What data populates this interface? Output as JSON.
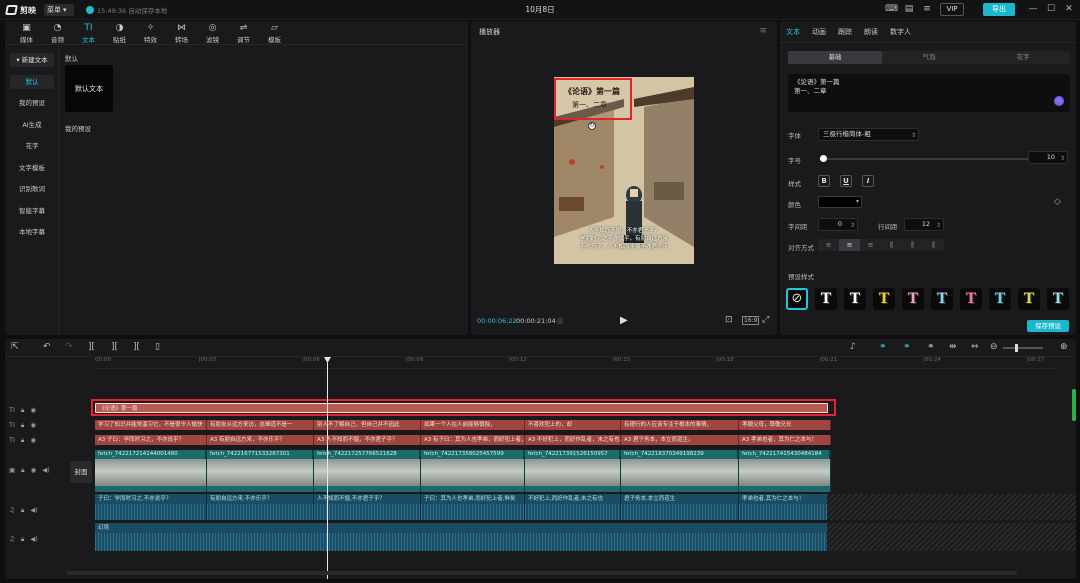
{
  "titlebar": {
    "app_name": "剪映",
    "menu_label": "菜单",
    "autosave_text": "15:49:36 自动保存本地",
    "doc_title": "10月8日",
    "vip_label": "VIP",
    "export_label": "导出"
  },
  "left_panel": {
    "tabs": [
      {
        "icon": "▣",
        "label": "媒体"
      },
      {
        "icon": "◔",
        "label": "音频"
      },
      {
        "icon": "TI",
        "label": "文本"
      },
      {
        "icon": "◑",
        "label": "贴纸"
      },
      {
        "icon": "✧",
        "label": "特效"
      },
      {
        "icon": "⋈",
        "label": "转场"
      },
      {
        "icon": "◎",
        "label": "滤镜"
      },
      {
        "icon": "⇌",
        "label": "调节"
      },
      {
        "icon": "▱",
        "label": "模板"
      }
    ],
    "sidebar": [
      "▾ 新建文本",
      "默认",
      "我的预设",
      "AI生成",
      "花字",
      "文字模板",
      "识别歌词",
      "智能字幕",
      "本地字幕"
    ],
    "section_default": "默认",
    "default_card": "默认文本",
    "section_my_presets": "我的预设"
  },
  "player": {
    "title": "播放器",
    "frame_title_line1": "《论语》第一篇",
    "frame_title_line2": "第一、二章",
    "subtitle_lines": [
      "人不知而不愠，不亦君子乎？",
      "学而时习之不亦说乎，有朋自远方来",
      "不亦乐乎，人不知而不愠不亦君子乎"
    ],
    "time_current": "00:00:06:22",
    "time_total": "00:00:21:04"
  },
  "right_panel": {
    "tabs": [
      "文本",
      "动画",
      "跟踪",
      "朗读",
      "数字人"
    ],
    "segments": [
      "基础",
      "气泡",
      "花字"
    ],
    "text_content_line1": "《论语》第一篇",
    "text_content_line2": "第一、二章",
    "font_label": "字体",
    "font_value": "三极行楷简体-粗",
    "size_label": "字号",
    "size_value": "10",
    "style_label": "样式",
    "style_buttons": [
      "B",
      "U",
      "I"
    ],
    "color_label": "颜色",
    "spacing_label": "字间距",
    "spacing_value": "0",
    "line_spacing_label": "行间距",
    "line_spacing_value": "12",
    "align_label": "对齐方式",
    "preset_label": "预设样式",
    "preset_letter": "T",
    "preset_colors": [
      "#ffffff",
      "#ffffff",
      "#f5d020",
      "#f2a1c0",
      "#8fd4ef",
      "#f27aa8",
      "#6fd3f0",
      "#e5d94a",
      "#9adff0"
    ],
    "save_preset_label": "保存预设",
    "accent": "#21c8dc"
  },
  "timeline": {
    "ticks": [
      "00:00",
      "|00:03",
      "|00:06",
      "|00:09",
      "|00:12",
      "|00:15",
      "|00:18",
      "|00:21",
      "|00:24",
      "|00:27"
    ],
    "title_clip": "《论语》第一篇",
    "subtitle_clips": [
      "学习了知识并能常温习它，不是很令人愉快",
      "有朋友从远方来访，这难道不是一",
      "别人不了解自己，但自己并不因此",
      "如果一个人在人前能够慎独，",
      "不喜欢犯上的，却",
      "有德行的人应该专注于根本的事情，",
      "孝顺父母，尊敬兄长"
    ],
    "subtitle_clips2": [
      "A3 子曰：学而时习之，不亦说乎？",
      "A3 有朋自远方来，不亦乐乎？",
      "A3 人不知而不愠，不亦君子乎？",
      "A3 有子曰：其为人也孝弟，而好犯上者，鲜矣",
      "A3 不好犯上，而好作乱者，未之有也。",
      "A3 君子务本，本立而道生。",
      "A3 孝弟也者，其为仁之本与！"
    ],
    "video_clips": [
      "fetch_742217214144001480",
      "fetch_742216771533287301",
      "fetch_742217257766521628",
      "fetch_742217358025457599",
      "fetch_742217391526150957",
      "fetch_742218370349198239",
      "fetch_742217415430484184"
    ],
    "cover_label": "封面",
    "audio_clips": [
      "子曰：学而时习之,不亦说乎？",
      "有朋自远方来,不亦乐乎？",
      "人不知而不愠,不亦君子乎？",
      "子曰：其为人也孝弟,而好犯上者,鲜矣",
      "不好犯上,而好作乱者,未之有也",
      "君子务本,本立而道生",
      "孝弟也者,其为仁之本与！"
    ],
    "music_label": "幻境"
  }
}
